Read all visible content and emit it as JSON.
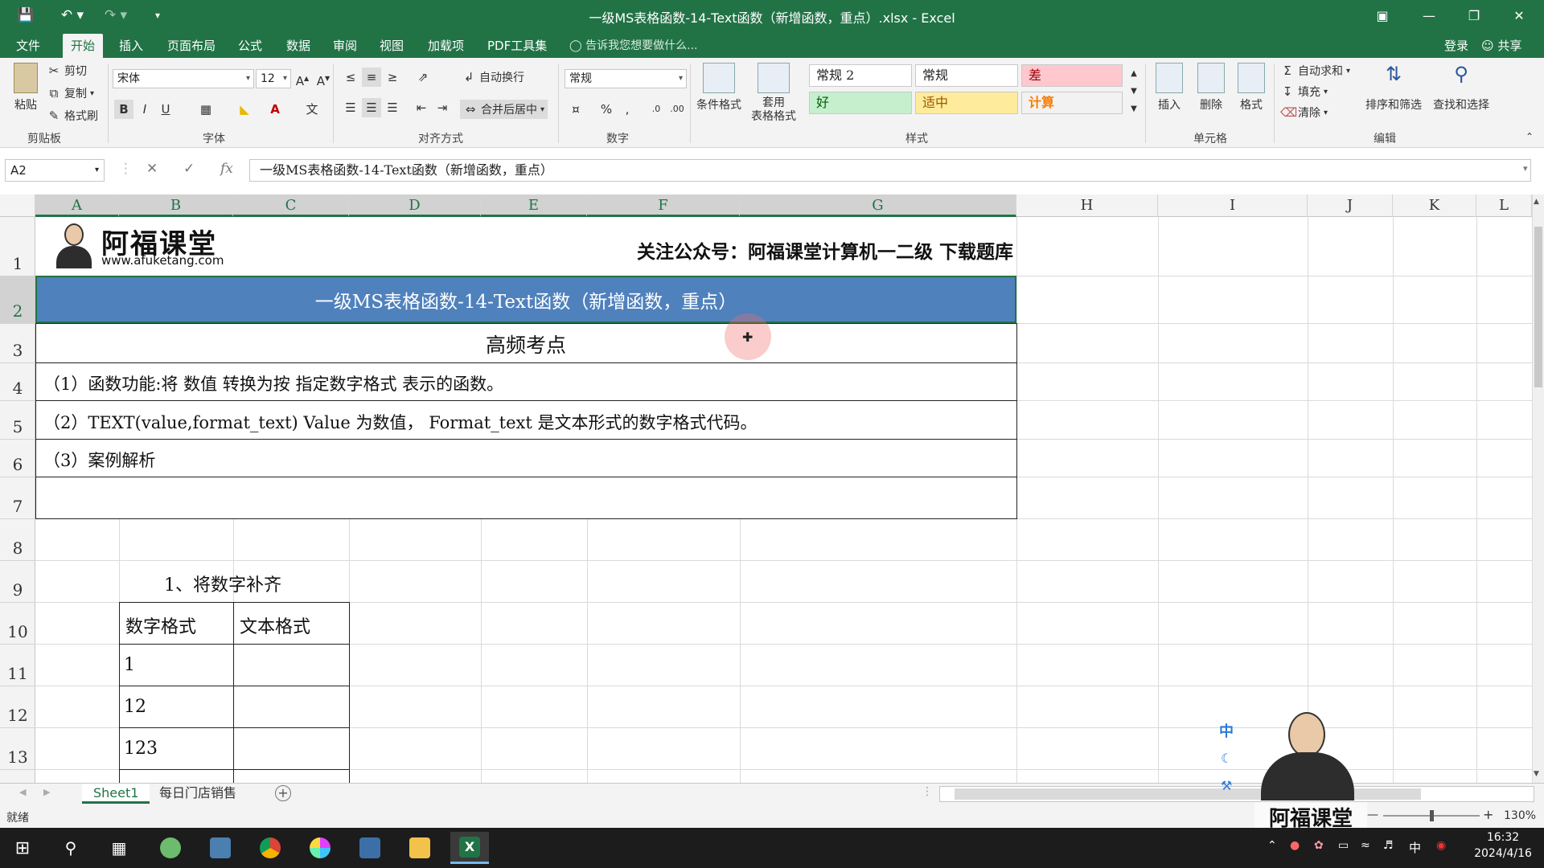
{
  "window": {
    "title": "一级MS表格函数-14-Text函数（新增函数，重点）.xlsx - Excel"
  },
  "tabs": {
    "items": [
      "文件",
      "开始",
      "插入",
      "页面布局",
      "公式",
      "数据",
      "审阅",
      "视图",
      "加载项",
      "PDF工具集"
    ],
    "active": "开始",
    "tell_me": "告诉我您想要做什么...",
    "login": "登录",
    "share": "共享"
  },
  "ribbon": {
    "clipboard": {
      "paste": "粘贴",
      "cut": "剪切",
      "copy": "复制",
      "format_painter": "格式刷",
      "label": "剪贴板"
    },
    "font": {
      "name": "宋体",
      "size": "12",
      "label": "字体"
    },
    "alignment": {
      "wrap": "自动换行",
      "merge": "合并后居中",
      "label": "对齐方式"
    },
    "number": {
      "format": "常规",
      "label": "数字"
    },
    "styles": {
      "cond_format": "条件格式",
      "table_format": "套用\n表格格式",
      "cells": [
        {
          "text": "常规 2",
          "bg": "#ffffff",
          "fg": "#222222"
        },
        {
          "text": "常规",
          "bg": "#ffffff",
          "fg": "#222222"
        },
        {
          "text": "差",
          "bg": "#ffc7ce",
          "fg": "#9c0006"
        },
        {
          "text": "好",
          "bg": "#c6efce",
          "fg": "#006100"
        },
        {
          "text": "适中",
          "bg": "#ffeb9c",
          "fg": "#9c5700"
        },
        {
          "text": "计算",
          "bg": "#f2f2f2",
          "fg": "#fa7d00"
        }
      ],
      "label": "样式"
    },
    "cells": {
      "insert": "插入",
      "delete": "删除",
      "format": "格式",
      "label": "单元格"
    },
    "editing": {
      "autosum": "自动求和",
      "fill": "填充",
      "clear": "清除",
      "sort": "排序和筛选",
      "find": "查找和选择",
      "label": "编辑"
    }
  },
  "formula_bar": {
    "name_box": "A2",
    "fx": "fx",
    "content": "一级MS表格函数-14-Text函数（新增函数，重点）"
  },
  "columns": [
    "A",
    "B",
    "C",
    "D",
    "E",
    "F",
    "G",
    "H",
    "I",
    "J",
    "K",
    "L"
  ],
  "rows": [
    "1",
    "2",
    "3",
    "4",
    "5",
    "6",
    "7",
    "8",
    "9",
    "10",
    "11",
    "12",
    "13"
  ],
  "sheet": {
    "logo_brand": "阿福课堂",
    "logo_url": "www.afuketang.com",
    "follow_text": "关注公众号：阿福课堂计算机一二级  下载题库",
    "banner_title": "一级MS表格函数-14-Text函数（新增函数，重点）",
    "section_heading": "高频考点",
    "point1": "（1）函数功能:将 数值 转换为按 指定数字格式 表示的函数。",
    "point2": "（2）TEXT(value,format_text) Value 为数值， Format_text 是文本形式的数字格式代码。",
    "point3": "（3）案例解析",
    "example_title": "1、将数字补齐",
    "table_headers": [
      "数字格式",
      "文本格式"
    ],
    "table_values": [
      "1",
      "12",
      "123"
    ]
  },
  "sheet_tabs": [
    "Sheet1",
    "每日门店销售"
  ],
  "status": {
    "ready": "就绪",
    "zoom": "130%"
  },
  "taskbar": {
    "time": "16:32",
    "date": "2024/4/16",
    "ime": "中"
  },
  "overlay": {
    "brand": "阿福课堂",
    "ime": "中"
  },
  "colors": {
    "excel_green": "#217346",
    "banner_blue": "#4f81bd"
  }
}
